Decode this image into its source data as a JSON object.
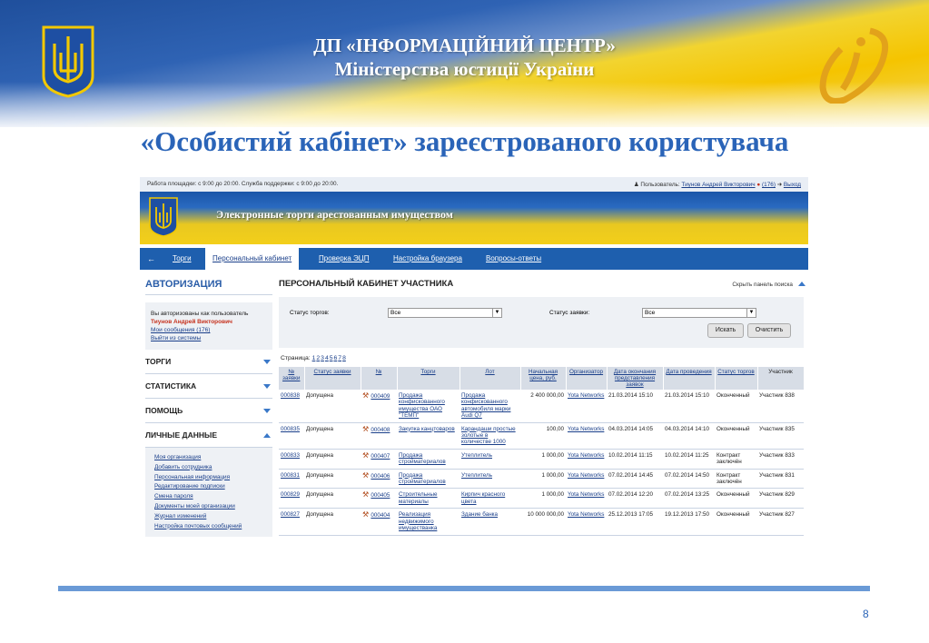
{
  "colors": {
    "accent_blue": "#2a64b8",
    "nav_blue": "#1e5fae",
    "yellow": "#f3cf1a",
    "link": "#1a3f8a"
  },
  "slide": {
    "org_title_line1": "ДП «ІНФОРМАЦІЙНИЙ ЦЕНТР»",
    "org_title_line2": "Міністерства юстиції України",
    "heading": "«Особистий кабінет» зареєстрованого користувача",
    "page_number": "8"
  },
  "topbar": {
    "hours": "Работа площадки: с 9:00 до 20:00. Служба поддержки: с 9:00 до 20:00.",
    "user_label": "Пользователь:",
    "user_name": "Тиунов Андрей Викторович",
    "messages": "(176)",
    "logout": "Выход"
  },
  "site": {
    "title": "Электронные торги арестованным имуществом"
  },
  "nav": {
    "tabs": [
      {
        "label": "Торги"
      },
      {
        "label": "Персональный кабинет"
      },
      {
        "label": "Проверка ЭЦП"
      },
      {
        "label": "Настройка браузера"
      },
      {
        "label": "Вопросы-ответы"
      }
    ]
  },
  "sidebar": {
    "auth_title": "АВТОРИЗАЦИЯ",
    "auth_text": "Вы авторизованы как пользователь",
    "auth_user": "Тиунов Андрей Викторович",
    "messages_link": "Мои сообщения (176)",
    "logout_link": "Выйти из системы",
    "menu": [
      {
        "label": "ТОРГИ"
      },
      {
        "label": "СТАТИСТИКА"
      },
      {
        "label": "ПОМОЩЬ"
      },
      {
        "label": "ЛИЧНЫЕ ДАННЫЕ"
      }
    ],
    "submenu": [
      "Моя организация",
      "Добавить сотрудника",
      "Персональная информация",
      "Редактирование подписки",
      "Смена пароля",
      "Документы моей организации",
      "Журнал изменений",
      "Настройка почтовых сообщений"
    ]
  },
  "main": {
    "title": "ПЕРСОНАЛЬНЫЙ КАБИНЕТ УЧАСТНИКА",
    "hide_panel": "Скрыть панель поиска",
    "filter": {
      "status_torg_label": "Статус торгов:",
      "status_torg_value": "Все",
      "status_zayavki_label": "Статус заявки:",
      "status_zayavki_value": "Все",
      "search_btn": "Искать",
      "clear_btn": "Очистить"
    },
    "pages_label": "Страница:",
    "pages": [
      "1",
      "2",
      "3",
      "4",
      "5",
      "6",
      "7",
      "8"
    ],
    "columns": [
      "№ заявки",
      "Статус заявки",
      "№",
      "Торги",
      "Лот",
      "Начальная цена, руб.",
      "Организатор",
      "Дата окончания представления заявок",
      "Дата проведения",
      "Статус торгов",
      "Участник"
    ],
    "rows": [
      {
        "zayavka": "000838",
        "status": "Допущена",
        "num": "000409",
        "torgi": "Продажа конфискованного имущества ОАО \"ТЕМП\"",
        "lot": "Продажа конфискованного автомобиля марки Audi Q7",
        "price": "2 400 000,00",
        "org": "Yota Networks",
        "date_end": "21.03.2014 15:10",
        "date_run": "21.03.2014 15:10",
        "status_torg": "Оконченный",
        "participant": "Участник 838"
      },
      {
        "zayavka": "000835",
        "status": "Допущена",
        "num": "000408",
        "torgi": "Закупка канцтоваров",
        "lot": "Карандаши простые золотые в количестве 1000",
        "price": "100,00",
        "org": "Yota Networks",
        "date_end": "04.03.2014 14:05",
        "date_run": "04.03.2014 14:10",
        "status_torg": "Оконченный",
        "participant": "Участник 835"
      },
      {
        "zayavka": "000833",
        "status": "Допущена",
        "num": "000407",
        "torgi": "Продажа стройматериалов",
        "lot": "Утеплитель",
        "price": "1 000,00",
        "org": "Yota Networks",
        "date_end": "10.02.2014 11:15",
        "date_run": "10.02.2014 11:25",
        "status_torg": "Контракт заключён",
        "participant": "Участник 833"
      },
      {
        "zayavka": "000831",
        "status": "Допущена",
        "num": "000406",
        "torgi": "Продажа стройматериалов",
        "lot": "Утеплитель",
        "price": "1 000,00",
        "org": "Yota Networks",
        "date_end": "07.02.2014 14:45",
        "date_run": "07.02.2014 14:50",
        "status_torg": "Контракт заключён",
        "participant": "Участник 831"
      },
      {
        "zayavka": "000829",
        "status": "Допущена",
        "num": "000405",
        "torgi": "Строительные материалы",
        "lot": "Кирпич красного цвета",
        "price": "1 000,00",
        "org": "Yota Networks",
        "date_end": "07.02.2014 12:20",
        "date_run": "07.02.2014 13:25",
        "status_torg": "Оконченный",
        "participant": "Участник 829"
      },
      {
        "zayavka": "000827",
        "status": "Допущена",
        "num": "000404",
        "torgi": "Реализация недвижимого имуществанка",
        "lot": "Здание банка",
        "price": "10 000 000,00",
        "org": "Yota Networks",
        "date_end": "25.12.2013 17:05",
        "date_run": "19.12.2013 17:50",
        "status_torg": "Оконченный",
        "participant": "Участник 827"
      }
    ]
  }
}
